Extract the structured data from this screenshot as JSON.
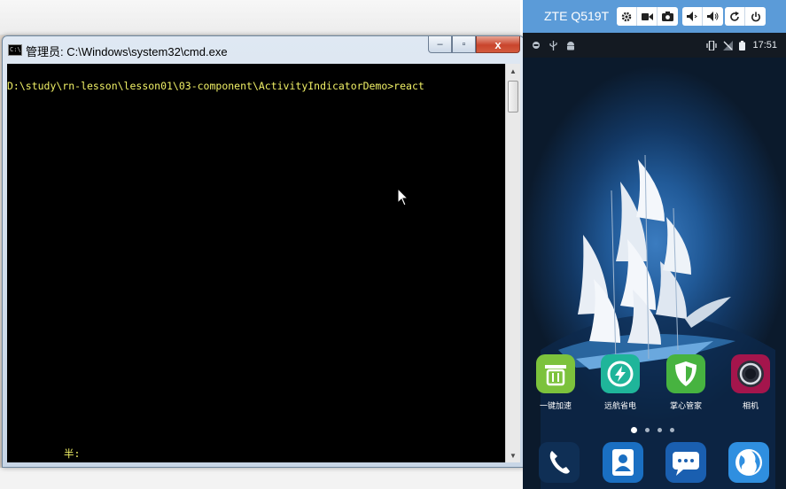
{
  "cmd_window": {
    "title": "管理员: C:\\Windows\\system32\\cmd.exe",
    "icon_text": "C:\\",
    "minimize": "–",
    "maximize": "▫",
    "close": "x",
    "console_lines": {
      "prompt": "D:\\study\\rn-lesson\\lesson01\\03-component\\ActivityIndicatorDemo>react",
      "ime": "半:"
    },
    "text_color": "#f0f066"
  },
  "phone": {
    "device_name": "ZTE Q519T",
    "toolbar_buttons": [
      "gear-icon",
      "video-icon",
      "camera-icon",
      "volume-down-icon",
      "volume-up-icon",
      "rotate-icon",
      "power-icon"
    ],
    "status_time": "17:51",
    "apps": [
      {
        "label": "一键加速",
        "color": "#7cc23c"
      },
      {
        "label": "远航省电",
        "color": "#1fb59a"
      },
      {
        "label": "掌心管家",
        "color": "#47b340"
      },
      {
        "label": "相机",
        "color": "#a4154c"
      }
    ],
    "dock": [
      "phone-icon",
      "contacts-icon",
      "messages-icon",
      "browser-icon"
    ],
    "page_indicator": {
      "pages": 4,
      "active": 1
    }
  }
}
